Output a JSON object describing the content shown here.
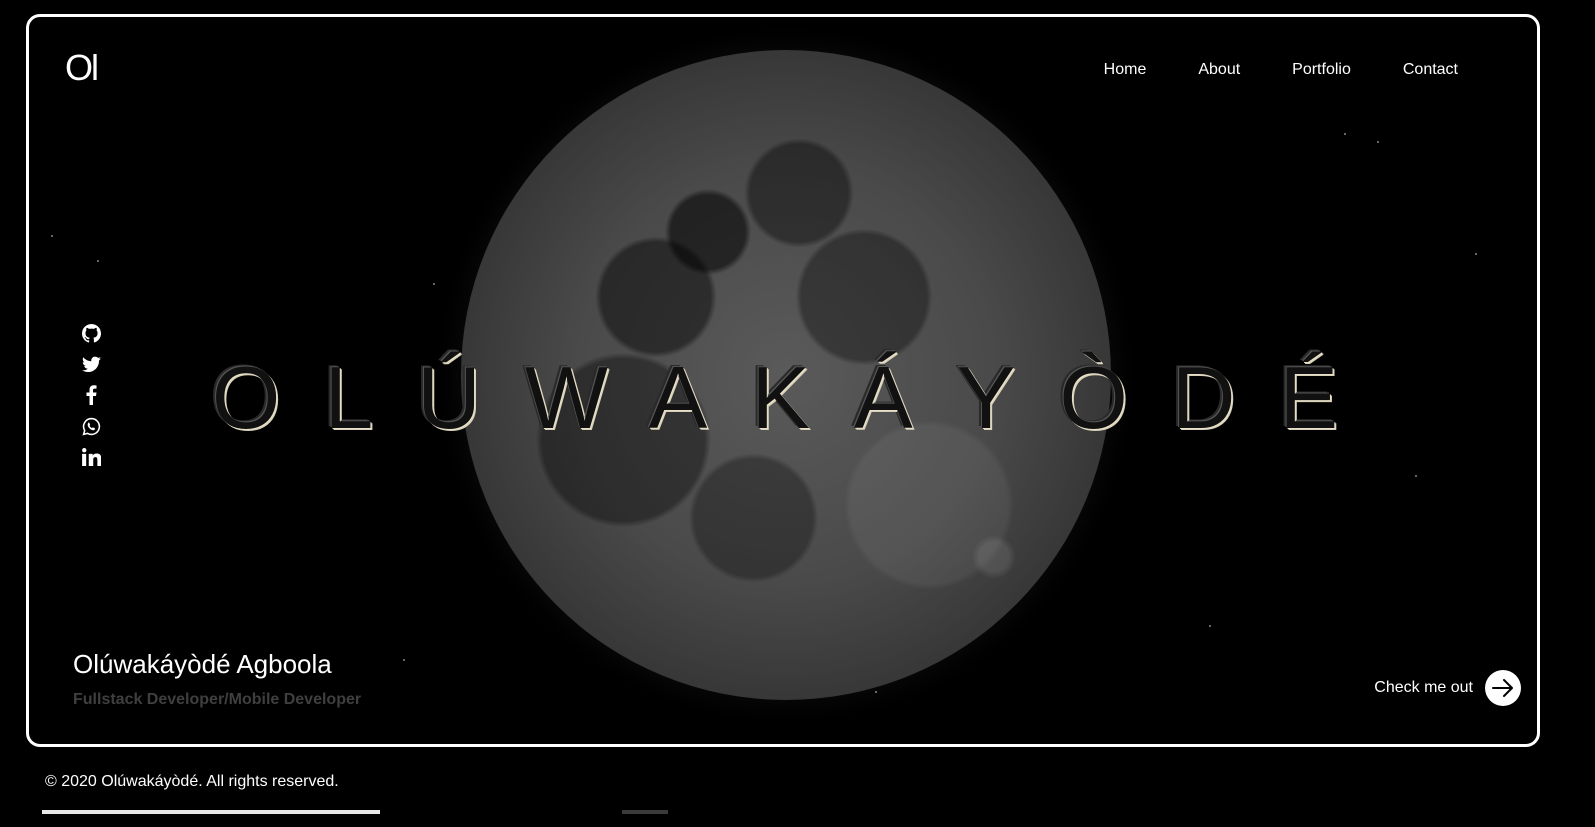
{
  "header": {
    "logo": "Ol",
    "nav": [
      "Home",
      "About",
      "Portfolio",
      "Contact"
    ]
  },
  "social": [
    "github-icon",
    "twitter-icon",
    "facebook-icon",
    "whatsapp-icon",
    "linkedin-icon"
  ],
  "hero": {
    "title": "OLÚWAKÁYÒDÉ",
    "name": "Olúwakáyòdé Agboola",
    "role": "Fullstack Developer/Mobile Developer",
    "cta": "Check me out"
  },
  "footer": {
    "copyright": "© 2020 Olúwakáyòdé. All rights reserved."
  },
  "colors": {
    "background": "#000000",
    "frame": "#ffffff",
    "role_text": "#3f3f3f"
  }
}
